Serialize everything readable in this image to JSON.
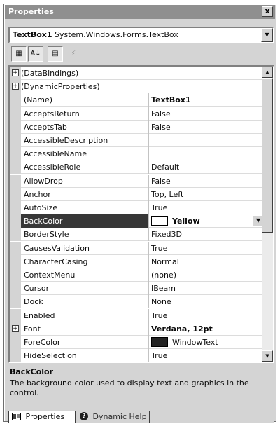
{
  "window": {
    "title": "Properties",
    "close_glyph": "x"
  },
  "object_selector": {
    "name": "TextBox1",
    "type": "System.Windows.Forms.TextBox",
    "dropdown_glyph": "▼"
  },
  "toolbar": {
    "categorized_glyph": "▦",
    "alphabetical_glyph": "A↓",
    "properties_glyph": "▤",
    "events_glyph": "⚡"
  },
  "grid": {
    "rows": [
      {
        "name": "(DataBindings)",
        "value": "",
        "category": true,
        "expand": "+"
      },
      {
        "name": "(DynamicProperties)",
        "value": "",
        "category": true,
        "expand": "+"
      },
      {
        "name": "(Name)",
        "value": "TextBox1",
        "bold": true
      },
      {
        "name": "AcceptsReturn",
        "value": "False"
      },
      {
        "name": "AcceptsTab",
        "value": "False"
      },
      {
        "name": "AccessibleDescription",
        "value": ""
      },
      {
        "name": "AccessibleName",
        "value": ""
      },
      {
        "name": "AccessibleRole",
        "value": "Default"
      },
      {
        "name": "AllowDrop",
        "value": "False"
      },
      {
        "name": "Anchor",
        "value": "Top, Left"
      },
      {
        "name": "AutoSize",
        "value": "True"
      },
      {
        "name": "BackColor",
        "value": "Yellow",
        "bold": true,
        "selected": true,
        "swatch": "white"
      },
      {
        "name": "BorderStyle",
        "value": "Fixed3D"
      },
      {
        "name": "CausesValidation",
        "value": "True"
      },
      {
        "name": "CharacterCasing",
        "value": "Normal"
      },
      {
        "name": "ContextMenu",
        "value": "(none)"
      },
      {
        "name": "Cursor",
        "value": "IBeam"
      },
      {
        "name": "Dock",
        "value": "None"
      },
      {
        "name": "Enabled",
        "value": "True"
      },
      {
        "name": "Font",
        "value": "Verdana, 12pt",
        "bold": true,
        "expand": "+"
      },
      {
        "name": "ForeColor",
        "value": "WindowText",
        "swatch": "dark"
      },
      {
        "name": "HideSelection",
        "value": "True"
      }
    ]
  },
  "description": {
    "title": "BackColor",
    "text": "The background color used to display text and graphics in the control."
  },
  "tabs": {
    "properties_label": "Properties",
    "dynamic_help_label": "Dynamic Help"
  },
  "colors": {
    "selection": "#3a3a3a",
    "chrome": "#d4d0c8",
    "titlebar": "#8e8e8e"
  }
}
